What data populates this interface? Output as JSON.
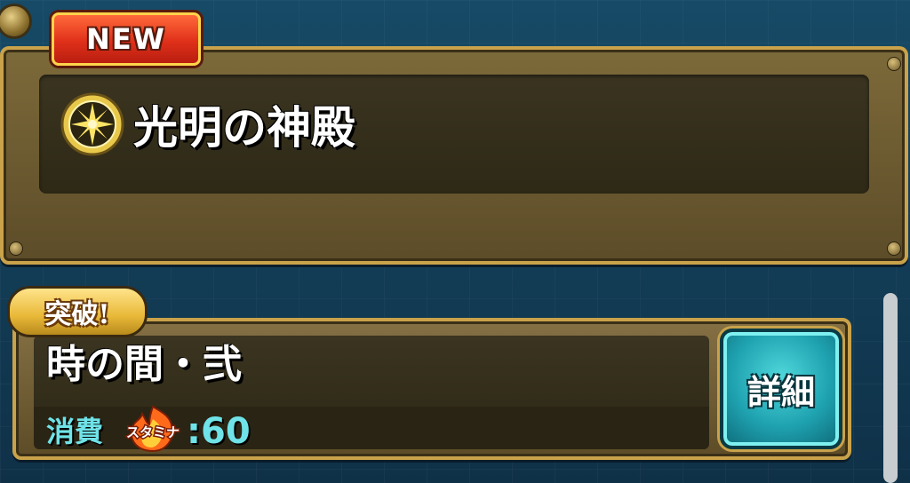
{
  "quest": {
    "badge": "NEW",
    "title": "光明の神殿",
    "element_icon": "light-element-icon"
  },
  "stage": {
    "tag": "突破!",
    "name": "時の間・弐",
    "cost_label": "消費",
    "stamina_label": "スタミナ",
    "cost_value": ":60",
    "detail_button": "詳細"
  },
  "colors": {
    "accent_cyan": "#6fe3e8",
    "frame_gold": "#c9a24a",
    "badge_red": "#e0301a"
  }
}
